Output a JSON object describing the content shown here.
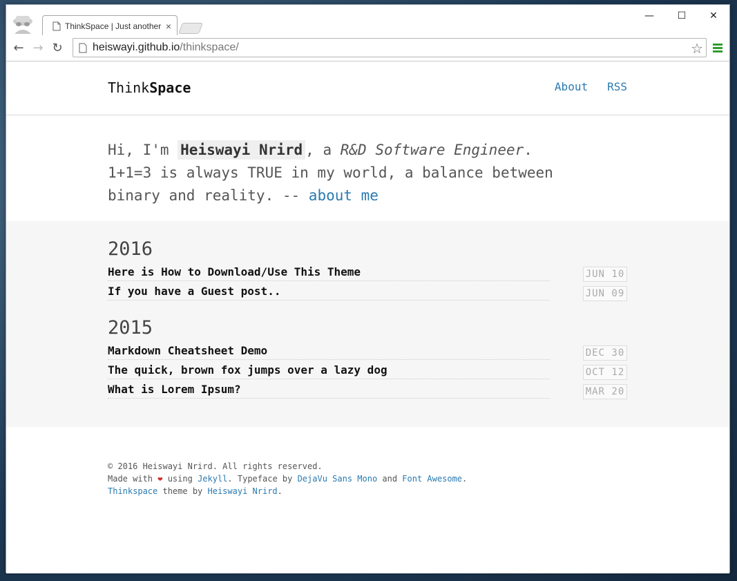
{
  "browser": {
    "tab_title": "ThinkSpace | Just another",
    "tab_close": "×",
    "url_host": "heiswayi.github.io",
    "url_path": "/thinkspace/",
    "window_controls": {
      "minimize": "—",
      "maximize": "☐",
      "close": "✕"
    }
  },
  "site": {
    "logo_light": "Think",
    "logo_bold": "Space",
    "nav": [
      "About",
      "RSS"
    ]
  },
  "intro": {
    "greeting": "Hi, I'm ",
    "name": "Heiswayi Nrird",
    "sep": ", a ",
    "role": "R&D Software Engineer",
    "period": ".",
    "line2": "1+1=3 is always TRUE in my world, a balance between",
    "line3": "binary and reality. -- ",
    "link": "about me"
  },
  "archive": [
    {
      "year": "2016",
      "posts": [
        {
          "title": "Here is How to Download/Use This Theme",
          "date": "JUN 10"
        },
        {
          "title": "If you have a Guest post..",
          "date": "JUN 09"
        }
      ]
    },
    {
      "year": "2015",
      "posts": [
        {
          "title": "Markdown Cheatsheet Demo",
          "date": "DEC 30"
        },
        {
          "title": "The quick, brown fox jumps over a lazy dog",
          "date": "OCT 12"
        },
        {
          "title": "What is Lorem Ipsum?",
          "date": "MAR 20"
        }
      ]
    }
  ],
  "footer": {
    "copyright": "© 2016 Heiswayi Nrird. All rights reserved.",
    "made_with": "Made with ",
    "heart": "❤",
    "using": " using ",
    "jekyll": "Jekyll",
    "typeface_by": ". Typeface by ",
    "dejavu": "DejaVu Sans Mono",
    "and": " and ",
    "fontawesome": "Font Awesome",
    "dot": ".",
    "thinkspace": "Thinkspace",
    "theme_by": " theme by ",
    "author": "Heiswayi Nrird",
    "end": "."
  },
  "colors": {
    "link": "#2a7ab0",
    "heart": "#d32b2b",
    "posts_bg": "#f6f6f6"
  }
}
